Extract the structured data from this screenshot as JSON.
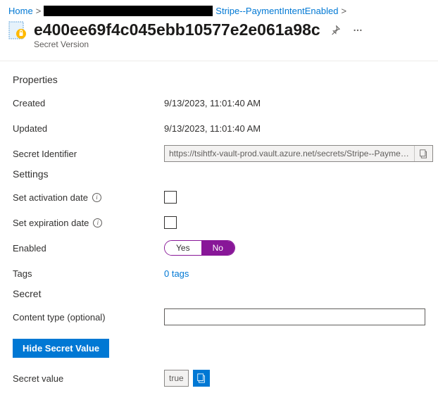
{
  "breadcrumb": {
    "home": "Home",
    "parent": "Stripe--PaymentIntentEnabled"
  },
  "header": {
    "title": "e400ee69f4c045ebb10577e2e061a98c",
    "subtitle": "Secret Version"
  },
  "sections": {
    "properties": "Properties",
    "settings": "Settings",
    "secret": "Secret"
  },
  "properties": {
    "created_label": "Created",
    "created_value": "9/13/2023, 11:01:40 AM",
    "updated_label": "Updated",
    "updated_value": "9/13/2023, 11:01:40 AM",
    "identifier_label": "Secret Identifier",
    "identifier_value": "https://tsihtfx-vault-prod.vault.azure.net/secrets/Stripe--PaymentI…"
  },
  "settings": {
    "activation_label": "Set activation date",
    "expiration_label": "Set expiration date",
    "enabled_label": "Enabled",
    "toggle_yes": "Yes",
    "toggle_no": "No",
    "tags_label": "Tags",
    "tags_value": "0 tags"
  },
  "secret": {
    "content_type_label": "Content type (optional)",
    "content_type_value": "",
    "hide_button": "Hide Secret Value",
    "value_label": "Secret value",
    "value": "true"
  }
}
